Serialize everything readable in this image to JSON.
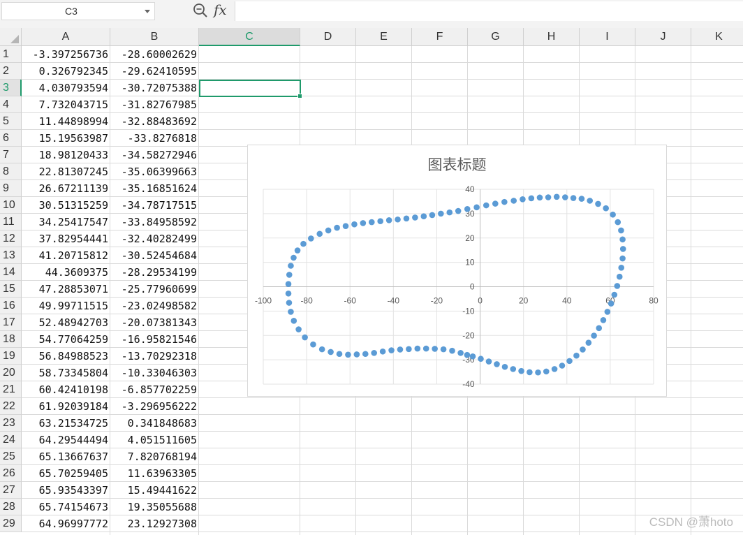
{
  "name_box": "C3",
  "formula_value": "",
  "columns": [
    "A",
    "B",
    "C",
    "D",
    "E",
    "F",
    "G",
    "H",
    "I",
    "J",
    "K"
  ],
  "selected_column": "C",
  "selected_row": 3,
  "rows": [
    {
      "n": "1",
      "a": "-3.397256736",
      "b": "-28.60002629"
    },
    {
      "n": "2",
      "a": "0.326792345",
      "b": "-29.62410595"
    },
    {
      "n": "3",
      "a": "4.030793594",
      "b": "-30.72075388"
    },
    {
      "n": "4",
      "a": "7.732043715",
      "b": "-31.82767985"
    },
    {
      "n": "5",
      "a": "11.44898994",
      "b": "-32.88483692"
    },
    {
      "n": "6",
      "a": "15.19563987",
      "b": "-33.8276818"
    },
    {
      "n": "7",
      "a": "18.98120433",
      "b": "-34.58272946"
    },
    {
      "n": "8",
      "a": "22.81307245",
      "b": "-35.06399663"
    },
    {
      "n": "9",
      "a": "26.67211139",
      "b": "-35.16851624"
    },
    {
      "n": "10",
      "a": "30.51315259",
      "b": "-34.78717515"
    },
    {
      "n": "11",
      "a": "34.25417547",
      "b": "-33.84958592"
    },
    {
      "n": "12",
      "a": "37.82954441",
      "b": "-32.40282499"
    },
    {
      "n": "13",
      "a": "41.20715812",
      "b": "-30.52454684"
    },
    {
      "n": "14",
      "a": "44.3609375",
      "b": "-28.29534199"
    },
    {
      "n": "15",
      "a": "47.28853071",
      "b": "-25.77960699"
    },
    {
      "n": "16",
      "a": "49.99711515",
      "b": "-23.02498582"
    },
    {
      "n": "17",
      "a": "52.48942703",
      "b": "-20.07381343"
    },
    {
      "n": "18",
      "a": "54.77064259",
      "b": "-16.95821546"
    },
    {
      "n": "19",
      "a": "56.84988523",
      "b": "-13.70292318"
    },
    {
      "n": "20",
      "a": "58.73345804",
      "b": "-10.33046303"
    },
    {
      "n": "21",
      "a": "60.42410198",
      "b": "-6.857702259"
    },
    {
      "n": "22",
      "a": "61.92039184",
      "b": "-3.296956222"
    },
    {
      "n": "23",
      "a": "63.21534725",
      "b": "0.341848683"
    },
    {
      "n": "24",
      "a": "64.29544494",
      "b": "4.051511605"
    },
    {
      "n": "25",
      "a": "65.13667637",
      "b": "7.820768194"
    },
    {
      "n": "26",
      "a": "65.70259405",
      "b": "11.63963305"
    },
    {
      "n": "27",
      "a": "65.93543397",
      "b": "15.49441622"
    },
    {
      "n": "28",
      "a": "65.74154673",
      "b": "19.35055688"
    },
    {
      "n": "29",
      "a": "64.96997772",
      "b": "23.12927308"
    }
  ],
  "chart_data": {
    "type": "scatter",
    "title": "图表标题",
    "xlabel": "",
    "ylabel": "",
    "xlim": [
      -100,
      80
    ],
    "ylim": [
      -40,
      40
    ],
    "xticks": [
      -100,
      -80,
      -60,
      -40,
      -20,
      0,
      20,
      40,
      60,
      80
    ],
    "yticks": [
      -40,
      -30,
      -20,
      -10,
      0,
      10,
      20,
      30,
      40
    ],
    "grid": true,
    "marker_color": "#5b9bd5",
    "points": [
      [
        -3.4,
        -28.6
      ],
      [
        0.3,
        -29.6
      ],
      [
        4.0,
        -30.7
      ],
      [
        7.7,
        -31.8
      ],
      [
        11.4,
        -32.9
      ],
      [
        15.2,
        -33.8
      ],
      [
        19.0,
        -34.6
      ],
      [
        22.8,
        -35.1
      ],
      [
        26.7,
        -35.2
      ],
      [
        30.5,
        -34.8
      ],
      [
        34.3,
        -33.8
      ],
      [
        37.8,
        -32.4
      ],
      [
        41.2,
        -30.5
      ],
      [
        44.4,
        -28.3
      ],
      [
        47.3,
        -25.8
      ],
      [
        50.0,
        -23.0
      ],
      [
        52.5,
        -20.1
      ],
      [
        54.8,
        -17.0
      ],
      [
        56.8,
        -13.7
      ],
      [
        58.7,
        -10.3
      ],
      [
        60.4,
        -6.9
      ],
      [
        61.9,
        -3.3
      ],
      [
        63.2,
        0.3
      ],
      [
        64.3,
        4.1
      ],
      [
        65.1,
        7.8
      ],
      [
        65.7,
        11.6
      ],
      [
        65.9,
        15.5
      ],
      [
        65.7,
        19.4
      ],
      [
        65.0,
        23.1
      ],
      [
        63.5,
        26.5
      ],
      [
        61.2,
        29.6
      ],
      [
        58.0,
        32.2
      ],
      [
        54.4,
        34.0
      ],
      [
        50.6,
        35.3
      ],
      [
        46.8,
        36.1
      ],
      [
        43.0,
        36.4
      ],
      [
        39.2,
        36.7
      ],
      [
        35.3,
        36.9
      ],
      [
        31.4,
        36.7
      ],
      [
        27.5,
        36.6
      ],
      [
        23.6,
        36.3
      ],
      [
        19.6,
        35.9
      ],
      [
        15.5,
        35.3
      ],
      [
        11.2,
        34.8
      ],
      [
        7.0,
        34.1
      ],
      [
        2.8,
        33.4
      ],
      [
        -1.6,
        32.6
      ],
      [
        -5.9,
        31.9
      ],
      [
        -10.1,
        31.1
      ],
      [
        -14.1,
        30.5
      ],
      [
        -18.1,
        30.0
      ],
      [
        -22.1,
        29.4
      ],
      [
        -26.0,
        28.9
      ],
      [
        -30.0,
        28.4
      ],
      [
        -34.0,
        28.0
      ],
      [
        -38.0,
        27.6
      ],
      [
        -42.0,
        27.3
      ],
      [
        -46.0,
        26.9
      ],
      [
        -50.0,
        26.5
      ],
      [
        -54.0,
        26.1
      ],
      [
        -58.0,
        25.6
      ],
      [
        -62.0,
        24.9
      ],
      [
        -66.0,
        24.2
      ],
      [
        -70.0,
        23.1
      ],
      [
        -74.0,
        21.7
      ],
      [
        -78.0,
        19.8
      ],
      [
        -81.5,
        17.6
      ],
      [
        -84.2,
        14.9
      ],
      [
        -86.0,
        11.9
      ],
      [
        -87.3,
        8.6
      ],
      [
        -88.0,
        4.9
      ],
      [
        -88.4,
        1.1
      ],
      [
        -88.4,
        -2.8
      ],
      [
        -88.1,
        -6.6
      ],
      [
        -87.3,
        -10.3
      ],
      [
        -85.9,
        -14.0
      ],
      [
        -83.7,
        -17.5
      ],
      [
        -80.8,
        -20.8
      ],
      [
        -77.0,
        -23.7
      ],
      [
        -72.9,
        -25.7
      ],
      [
        -68.9,
        -26.8
      ],
      [
        -64.9,
        -27.6
      ],
      [
        -60.9,
        -27.9
      ],
      [
        -56.9,
        -27.8
      ],
      [
        -52.9,
        -27.6
      ],
      [
        -48.9,
        -27.2
      ],
      [
        -44.9,
        -26.6
      ],
      [
        -40.9,
        -26.1
      ],
      [
        -36.9,
        -25.8
      ],
      [
        -32.9,
        -25.6
      ],
      [
        -28.9,
        -25.4
      ],
      [
        -24.9,
        -25.4
      ],
      [
        -20.9,
        -25.5
      ],
      [
        -16.9,
        -25.7
      ],
      [
        -12.9,
        -26.3
      ],
      [
        -9.0,
        -27.2
      ],
      [
        -6.0,
        -28.0
      ]
    ]
  },
  "watermark": "CSDN @萧hoto"
}
